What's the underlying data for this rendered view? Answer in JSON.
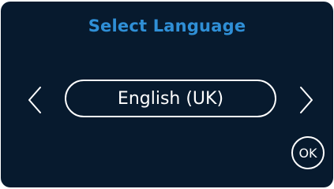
{
  "screen": {
    "title": "Select Language",
    "language": {
      "current_value": "English (UK)"
    },
    "prev_icon": "chevron-left-icon",
    "next_icon": "chevron-right-icon",
    "ok_label": "OK"
  },
  "colors": {
    "background": "#071a2e",
    "title": "#2f8fd6",
    "foreground": "#ffffff"
  }
}
